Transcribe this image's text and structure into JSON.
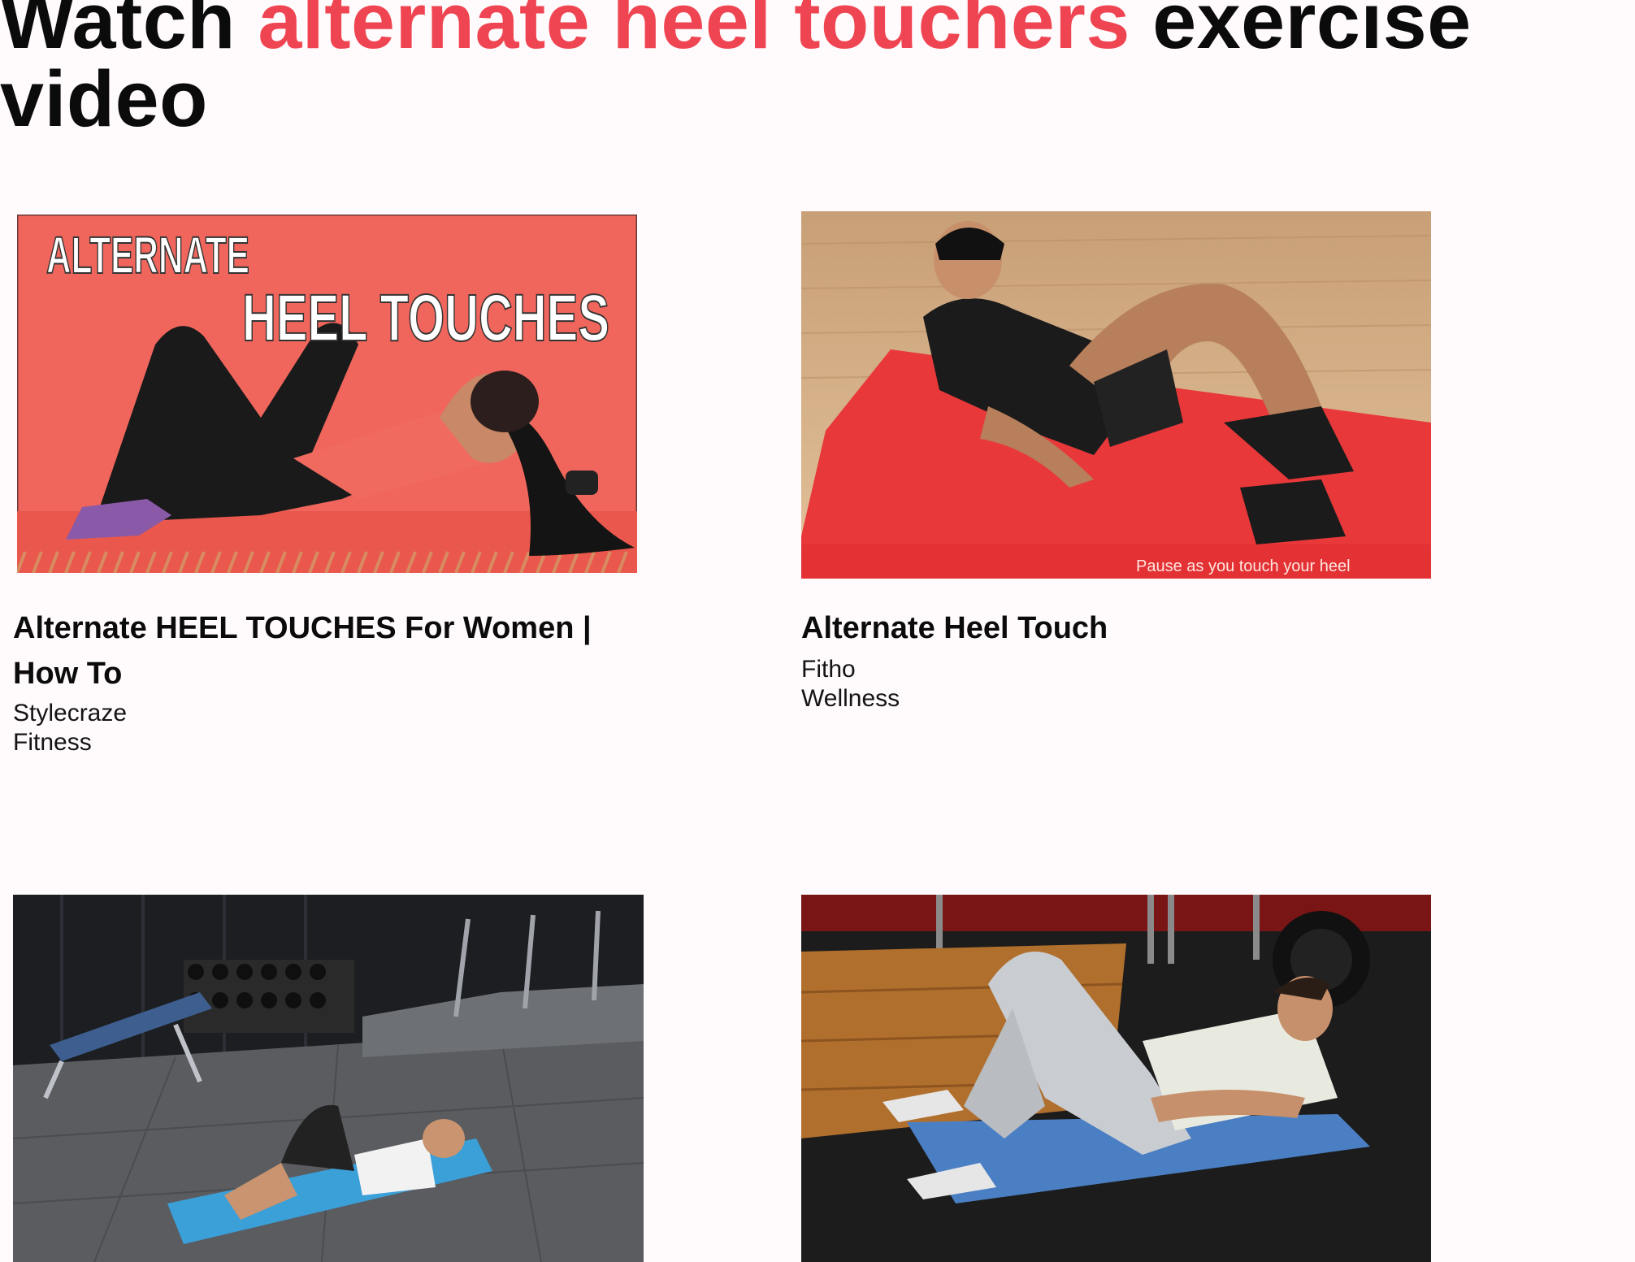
{
  "header": {
    "title_prefix": "Watch ",
    "title_highlight": "alternate heel touchers",
    "title_suffix": " exercise video"
  },
  "videos": [
    {
      "title": "Alternate HEEL TOUCHES For Women | How To",
      "channel": "Stylecraze Fitness",
      "thumb_text_line1": "ALTERNATE",
      "thumb_text_line2": "HEEL TOUCHES"
    },
    {
      "title": "Alternate Heel Touch",
      "channel": "Fitho Wellness",
      "thumb_caption": "Pause as you touch your heel"
    },
    {},
    {}
  ],
  "colors": {
    "background": "#fffafb",
    "accent": "#ef4451",
    "text": "#0b0b0b"
  }
}
